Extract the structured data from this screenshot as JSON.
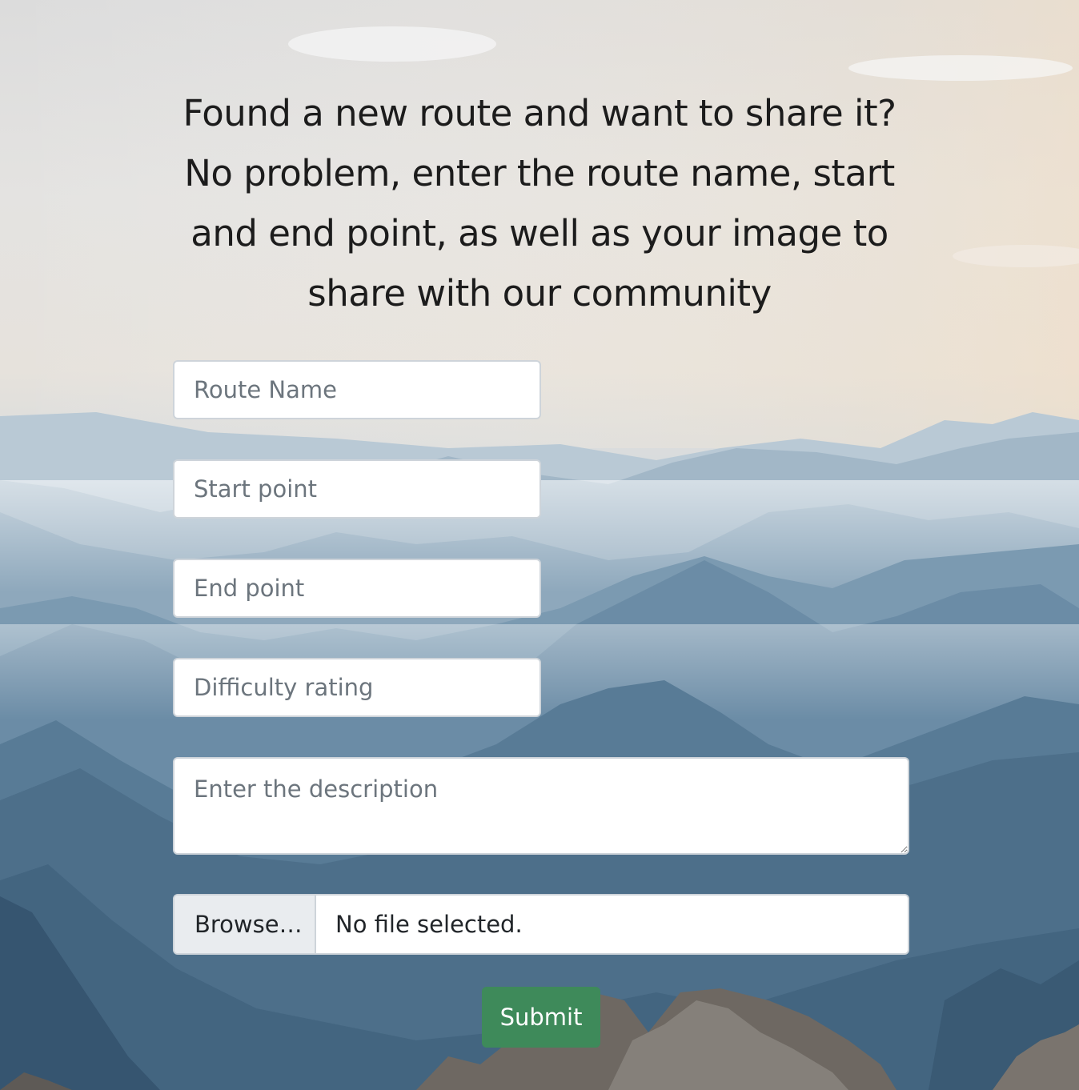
{
  "background": {
    "description_icon": "mountain-landscape-photo",
    "sky_color": "#e4e4e3",
    "mountain_color": "#5d7f9a"
  },
  "intro_text": "Found a new route and want to share it? No problem, enter the route name, start and end point, as well as your image to share with our community",
  "form": {
    "route_name": {
      "placeholder": "Route Name",
      "value": ""
    },
    "start_point": {
      "placeholder": "Start point",
      "value": ""
    },
    "end_point": {
      "placeholder": "End point",
      "value": ""
    },
    "difficulty_rating": {
      "placeholder": "Difficulty rating",
      "value": ""
    },
    "description": {
      "placeholder": "Enter the description",
      "value": ""
    },
    "file": {
      "browse_label": "Browse…",
      "status": "No file selected."
    },
    "submit_label": "Submit"
  },
  "colors": {
    "submit_button": "#3e8a5a",
    "input_border": "#ced4da",
    "browse_background": "#e9ecef"
  }
}
